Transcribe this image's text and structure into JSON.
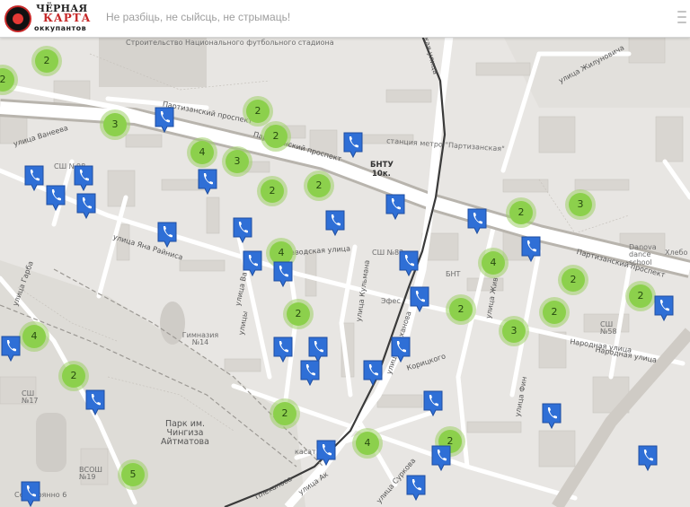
{
  "header": {
    "logo": {
      "line1": "ЧЁРНАЯ",
      "line2": "КАРТА",
      "line3": "оккупантов"
    },
    "search": {
      "placeholder": "Не разбіць, не сыйсць, не стрымаць!"
    },
    "close_icon": "close-icon"
  },
  "map": {
    "background": "#e8e6e3",
    "labels": {
      "stadium": "Строительство Национального футбольного стадиона",
      "partizanskiy_1": "Партизанский проспект",
      "partizanskiy_2": "Партизанский проспект",
      "partizanskiy_3": "Партизанский проспект",
      "vaneeva": "улица Ванеева",
      "zhilunovicha": "улица Жилуновича",
      "usnaya": "ская улица",
      "metro": "станция метро \"Партизанская\"",
      "bntu": "БНТУ",
      "bntu_sub": "10к.",
      "sh98": "СШ №98",
      "yana_raynisa": "улица Яна Райниса",
      "zavodskaya": "Заводская улица",
      "ul_va": "улица Ва",
      "ul_kulmana": "улица Кульмана",
      "sh82": "СШ №82",
      "gymnasium": "Гимназия №14",
      "park": "Парк им. Чингиза Айтматова",
      "sh17": "СШ №17",
      "vsosh19": "ВСОШ №19",
      "serebryanno": "Серебрянно 6",
      "ul_zhiv": "улица Жив",
      "narodnaya_1": "Народная улица",
      "narodnaya_2": "Народная улица",
      "ul_fin": "улица Фин",
      "sh58": "СШ №58",
      "danova": "Danova dance school",
      "khlebo": "Хлебо",
      "ul_garba": "улица Гарба",
      "dorizhskogo": "Корицкого",
      "efes": "Эфес",
      "ul_plekhanova": "улица Плеханова",
      "plekhanova_2": "Плеханова",
      "ul_surkova": "улица Суркова",
      "bnt": "БНТ",
      "ul_ak": "улица Ак",
      "kasatkina": "касат",
      "uki": "улицы"
    },
    "clusters": [
      {
        "count": "2"
      },
      {
        "count": "2"
      },
      {
        "count": "3"
      },
      {
        "count": "2"
      },
      {
        "count": "2"
      },
      {
        "count": "4"
      },
      {
        "count": "3"
      },
      {
        "count": "2"
      },
      {
        "count": "2"
      },
      {
        "count": "4"
      },
      {
        "count": "2"
      },
      {
        "count": "3"
      },
      {
        "count": "4"
      },
      {
        "count": "2"
      },
      {
        "count": "2"
      },
      {
        "count": "2"
      },
      {
        "count": "3"
      },
      {
        "count": "2"
      },
      {
        "count": "4"
      },
      {
        "count": "2"
      },
      {
        "count": "2"
      },
      {
        "count": "2"
      },
      {
        "count": "4"
      },
      {
        "count": "2"
      },
      {
        "count": "5"
      }
    ],
    "pins": [
      {
        "icon": "phone-icon"
      },
      {
        "icon": "phone-icon"
      },
      {
        "icon": "phone-icon"
      },
      {
        "icon": "phone-icon"
      },
      {
        "icon": "phone-icon"
      },
      {
        "icon": "phone-icon"
      },
      {
        "icon": "phone-icon"
      },
      {
        "icon": "phone-icon"
      },
      {
        "icon": "phone-icon"
      },
      {
        "icon": "phone-icon"
      },
      {
        "icon": "phone-icon"
      },
      {
        "icon": "phone-icon"
      },
      {
        "icon": "phone-icon"
      },
      {
        "icon": "phone-icon"
      },
      {
        "icon": "phone-icon"
      },
      {
        "icon": "phone-icon"
      },
      {
        "icon": "phone-icon"
      },
      {
        "icon": "phone-icon"
      },
      {
        "icon": "phone-icon"
      },
      {
        "icon": "phone-icon"
      },
      {
        "icon": "phone-icon"
      },
      {
        "icon": "phone-icon"
      },
      {
        "icon": "phone-icon"
      },
      {
        "icon": "phone-icon"
      },
      {
        "icon": "phone-icon"
      },
      {
        "icon": "phone-icon"
      },
      {
        "icon": "phone-icon"
      },
      {
        "icon": "phone-icon"
      },
      {
        "icon": "phone-icon"
      },
      {
        "icon": "phone-icon"
      },
      {
        "icon": "phone-icon"
      },
      {
        "icon": "phone-icon"
      }
    ],
    "colors": {
      "cluster_outer": "#9ed068",
      "cluster_inner": "#8cd04c",
      "pin": "#2f6fd6",
      "road_main": "#ffffff",
      "building": "#d9d6d1",
      "railway": "#3a3a3a"
    }
  }
}
